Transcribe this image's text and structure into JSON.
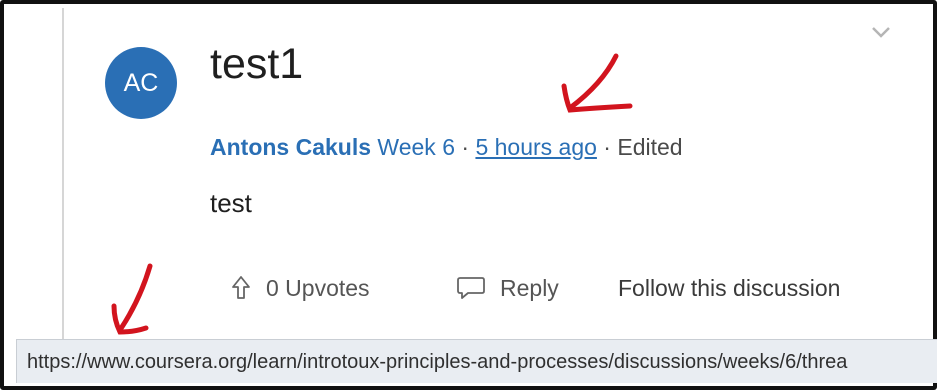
{
  "post": {
    "avatar_initials": "AC",
    "title": "test1",
    "author": "Antons Cakuls",
    "week": "Week 6",
    "separator": " · ",
    "time": "5 hours ago",
    "edited": "Edited",
    "body": "test"
  },
  "actions": {
    "upvotes_label": "0 Upvotes",
    "reply_label": "Reply",
    "follow_label": "Follow this discussion"
  },
  "status_url": "https://www.coursera.org/learn/introtoux-principles-and-processes/discussions/weeks/6/threa",
  "icons": {
    "collapse": "chevron-down-icon",
    "upvote": "upvote-arrow-icon",
    "reply": "speech-bubble-icon"
  },
  "colors": {
    "accent": "#2a6fb5",
    "annotation": "#d2141e"
  }
}
